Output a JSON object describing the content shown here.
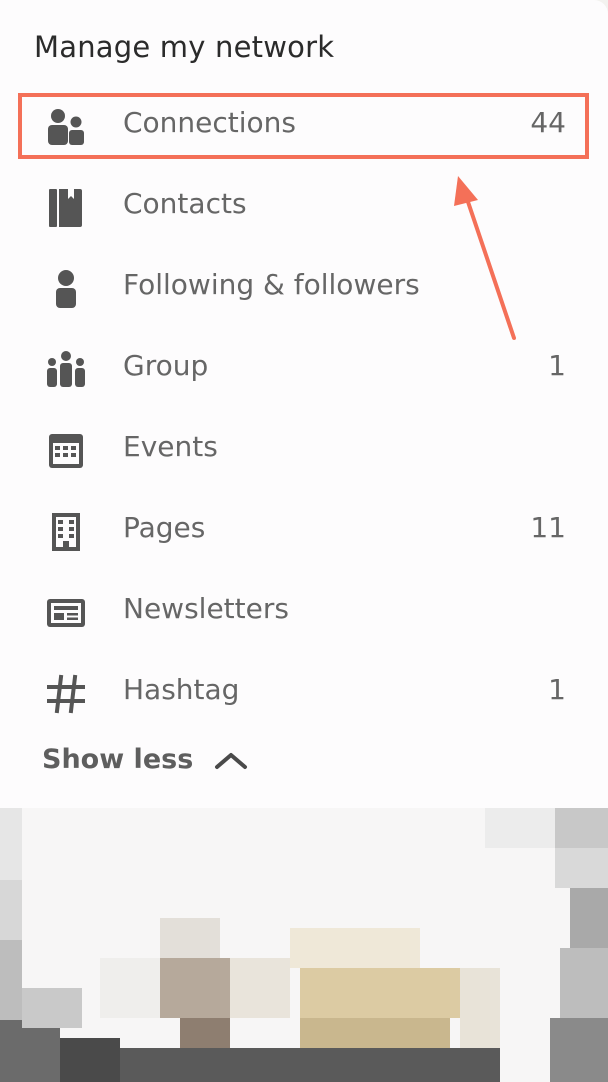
{
  "section": {
    "title": "Manage my network"
  },
  "items": [
    {
      "label": "Connections",
      "count": "44",
      "icon": "people-icon"
    },
    {
      "label": "Contacts",
      "count": "",
      "icon": "contact-book-icon"
    },
    {
      "label": "Following & followers",
      "count": "",
      "icon": "person-icon"
    },
    {
      "label": "Group",
      "count": "1",
      "icon": "group-icon"
    },
    {
      "label": "Events",
      "count": "",
      "icon": "calendar-icon"
    },
    {
      "label": "Pages",
      "count": "11",
      "icon": "building-icon"
    },
    {
      "label": "Newsletters",
      "count": "",
      "icon": "newspaper-icon"
    },
    {
      "label": "Hashtag",
      "count": "1",
      "icon": "hashtag-icon"
    }
  ],
  "show_less": {
    "label": "Show less",
    "icon": "chevron-up-icon"
  },
  "annotation": {
    "color": "#f47058",
    "target": "Connections"
  },
  "colors": {
    "icon": "#555555",
    "text": "#666666",
    "title": "#2b2b2b",
    "panel": "#fdfcfd"
  }
}
